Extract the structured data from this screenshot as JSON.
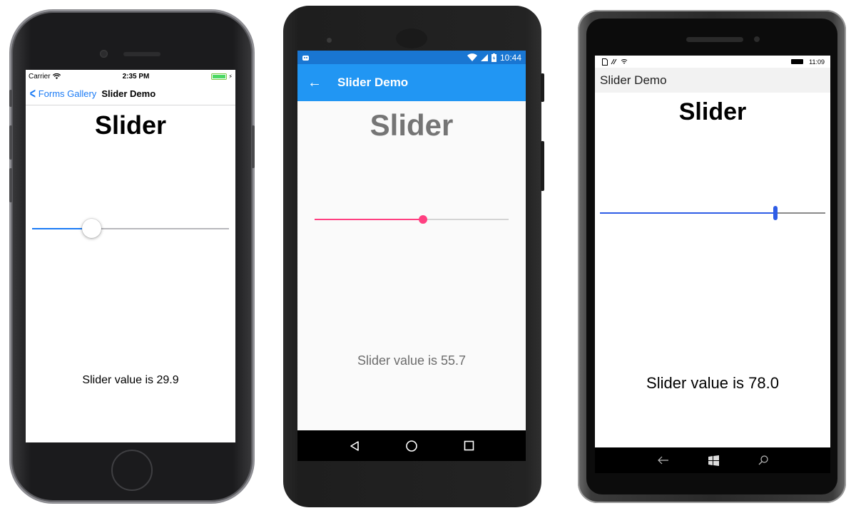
{
  "ios": {
    "status": {
      "carrier": "Carrier",
      "time": "2:35 PM"
    },
    "nav": {
      "back_label": "Forms Gallery",
      "title": "Slider Demo"
    },
    "heading": "Slider",
    "slider": {
      "value": 29.9,
      "min": 0,
      "max": 100
    },
    "value_text": "Slider value is 29.9",
    "colors": {
      "accent": "#1b7bf5"
    }
  },
  "android": {
    "status": {
      "time": "10:44"
    },
    "toolbar": {
      "title": "Slider Demo"
    },
    "heading": "Slider",
    "slider": {
      "value": 55.7,
      "min": 0,
      "max": 100
    },
    "value_text": "Slider value is 55.7",
    "nav_buttons": [
      "back-icon",
      "home-icon",
      "recents-icon"
    ],
    "colors": {
      "primary": "#2196f3",
      "accent": "#ff4081"
    }
  },
  "windows": {
    "status": {
      "time": "11:09"
    },
    "title": "Slider Demo",
    "heading": "Slider",
    "slider": {
      "value": 78.0,
      "min": 0,
      "max": 100
    },
    "value_text": "Slider value is 78.0",
    "nav_buttons": [
      "back-icon",
      "windows-start-icon",
      "search-icon"
    ],
    "colors": {
      "accent": "#2e5ce6"
    }
  }
}
